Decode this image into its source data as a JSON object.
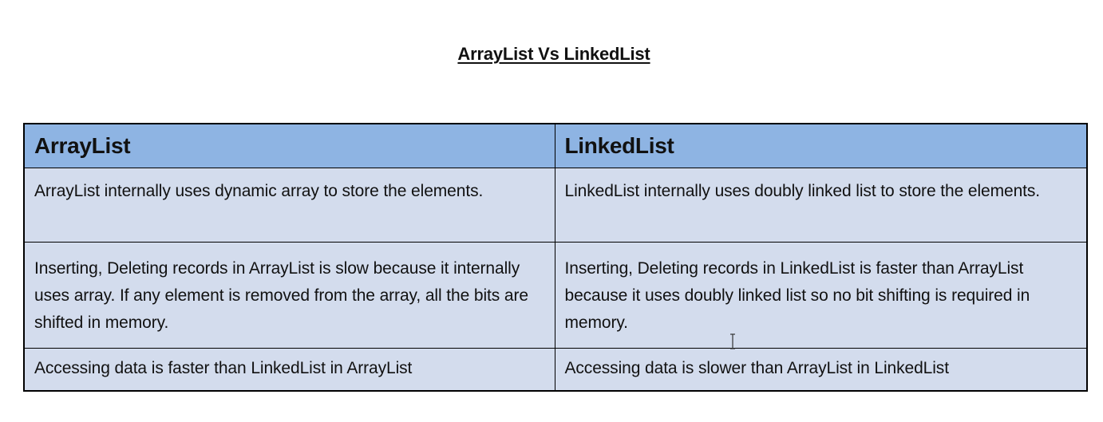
{
  "document": {
    "title": "ArrayList Vs LinkedList"
  },
  "table": {
    "headers": [
      "ArrayList",
      "LinkedList"
    ],
    "rows": [
      [
        "ArrayList internally uses dynamic array to store the elements.",
        "LinkedList internally uses doubly linked list to store the elements."
      ],
      [
        "Inserting, Deleting records in ArrayList is slow because it internally uses array. If any element is removed from the array, all the bits are shifted in memory.",
        "Inserting, Deleting records in LinkedList is faster than ArrayList because it uses doubly linked list so no bit shifting is required in memory."
      ],
      [
        "Accessing data is faster than LinkedList in ArrayList",
        "Accessing data is slower than ArrayList in LinkedList"
      ]
    ]
  },
  "colors": {
    "header_bg": "#8eb4e3",
    "cell_bg": "#d3dced",
    "border": "#000000"
  },
  "icons": {
    "cursor": "text-cursor-icon"
  }
}
